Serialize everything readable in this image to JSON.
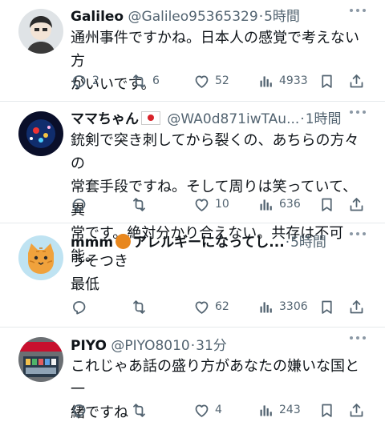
{
  "tweets": [
    {
      "name": "Galileo",
      "handle": "@Galileo95365329",
      "time": "5時間",
      "text": "通州事件ですかね。日本人の感覚で考えない方\nがいいです。",
      "replies": "2",
      "retweets": "6",
      "likes": "52",
      "views": "4933"
    },
    {
      "name": "ママちゃん",
      "handle": "@WA0d871iwTAu...",
      "time": "1時間",
      "text": "銃剣で突き刺してから裂くの、あちらの方々の\n常套手段ですね。そして周りは笑っていて、異\n常です。絶対分かり合えない。共存は不可能。",
      "replies": "",
      "retweets": "",
      "likes": "10",
      "views": "636"
    },
    {
      "name": "mmm",
      "name_suffix": "アレルギーになってし...",
      "time": "5時間",
      "text": "うそつき\n最低",
      "replies": "",
      "retweets": "",
      "likes": "62",
      "views": "3306"
    },
    {
      "name": "PIYO",
      "handle": "@PIYO8010",
      "time": "31分",
      "text": "これじゃあ話の盛り方があなたの嫌いな国と一\n緒ですね",
      "replies": "",
      "retweets": "",
      "likes": "4",
      "views": "243"
    }
  ],
  "separator": "·",
  "icons": [
    "reply-icon",
    "retweet-icon",
    "like-icon",
    "views-icon",
    "bookmark-icon",
    "share-icon",
    "more-icon"
  ]
}
